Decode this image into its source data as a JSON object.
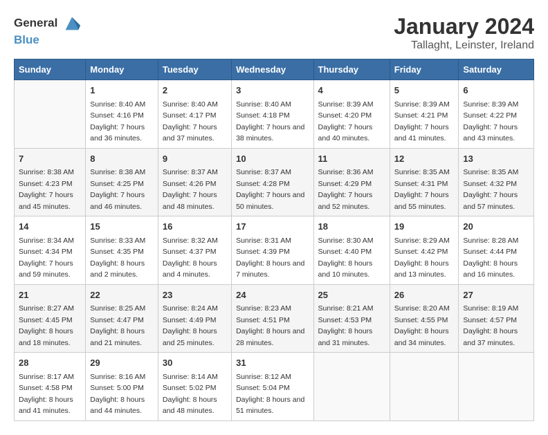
{
  "logo": {
    "general": "General",
    "blue": "Blue"
  },
  "title": "January 2024",
  "subtitle": "Tallaght, Leinster, Ireland",
  "days_of_week": [
    "Sunday",
    "Monday",
    "Tuesday",
    "Wednesday",
    "Thursday",
    "Friday",
    "Saturday"
  ],
  "weeks": [
    [
      {
        "day": "",
        "sunrise": "",
        "sunset": "",
        "daylight": ""
      },
      {
        "day": "1",
        "sunrise": "Sunrise: 8:40 AM",
        "sunset": "Sunset: 4:16 PM",
        "daylight": "Daylight: 7 hours and 36 minutes."
      },
      {
        "day": "2",
        "sunrise": "Sunrise: 8:40 AM",
        "sunset": "Sunset: 4:17 PM",
        "daylight": "Daylight: 7 hours and 37 minutes."
      },
      {
        "day": "3",
        "sunrise": "Sunrise: 8:40 AM",
        "sunset": "Sunset: 4:18 PM",
        "daylight": "Daylight: 7 hours and 38 minutes."
      },
      {
        "day": "4",
        "sunrise": "Sunrise: 8:39 AM",
        "sunset": "Sunset: 4:20 PM",
        "daylight": "Daylight: 7 hours and 40 minutes."
      },
      {
        "day": "5",
        "sunrise": "Sunrise: 8:39 AM",
        "sunset": "Sunset: 4:21 PM",
        "daylight": "Daylight: 7 hours and 41 minutes."
      },
      {
        "day": "6",
        "sunrise": "Sunrise: 8:39 AM",
        "sunset": "Sunset: 4:22 PM",
        "daylight": "Daylight: 7 hours and 43 minutes."
      }
    ],
    [
      {
        "day": "7",
        "sunrise": "Sunrise: 8:38 AM",
        "sunset": "Sunset: 4:23 PM",
        "daylight": "Daylight: 7 hours and 45 minutes."
      },
      {
        "day": "8",
        "sunrise": "Sunrise: 8:38 AM",
        "sunset": "Sunset: 4:25 PM",
        "daylight": "Daylight: 7 hours and 46 minutes."
      },
      {
        "day": "9",
        "sunrise": "Sunrise: 8:37 AM",
        "sunset": "Sunset: 4:26 PM",
        "daylight": "Daylight: 7 hours and 48 minutes."
      },
      {
        "day": "10",
        "sunrise": "Sunrise: 8:37 AM",
        "sunset": "Sunset: 4:28 PM",
        "daylight": "Daylight: 7 hours and 50 minutes."
      },
      {
        "day": "11",
        "sunrise": "Sunrise: 8:36 AM",
        "sunset": "Sunset: 4:29 PM",
        "daylight": "Daylight: 7 hours and 52 minutes."
      },
      {
        "day": "12",
        "sunrise": "Sunrise: 8:35 AM",
        "sunset": "Sunset: 4:31 PM",
        "daylight": "Daylight: 7 hours and 55 minutes."
      },
      {
        "day": "13",
        "sunrise": "Sunrise: 8:35 AM",
        "sunset": "Sunset: 4:32 PM",
        "daylight": "Daylight: 7 hours and 57 minutes."
      }
    ],
    [
      {
        "day": "14",
        "sunrise": "Sunrise: 8:34 AM",
        "sunset": "Sunset: 4:34 PM",
        "daylight": "Daylight: 7 hours and 59 minutes."
      },
      {
        "day": "15",
        "sunrise": "Sunrise: 8:33 AM",
        "sunset": "Sunset: 4:35 PM",
        "daylight": "Daylight: 8 hours and 2 minutes."
      },
      {
        "day": "16",
        "sunrise": "Sunrise: 8:32 AM",
        "sunset": "Sunset: 4:37 PM",
        "daylight": "Daylight: 8 hours and 4 minutes."
      },
      {
        "day": "17",
        "sunrise": "Sunrise: 8:31 AM",
        "sunset": "Sunset: 4:39 PM",
        "daylight": "Daylight: 8 hours and 7 minutes."
      },
      {
        "day": "18",
        "sunrise": "Sunrise: 8:30 AM",
        "sunset": "Sunset: 4:40 PM",
        "daylight": "Daylight: 8 hours and 10 minutes."
      },
      {
        "day": "19",
        "sunrise": "Sunrise: 8:29 AM",
        "sunset": "Sunset: 4:42 PM",
        "daylight": "Daylight: 8 hours and 13 minutes."
      },
      {
        "day": "20",
        "sunrise": "Sunrise: 8:28 AM",
        "sunset": "Sunset: 4:44 PM",
        "daylight": "Daylight: 8 hours and 16 minutes."
      }
    ],
    [
      {
        "day": "21",
        "sunrise": "Sunrise: 8:27 AM",
        "sunset": "Sunset: 4:45 PM",
        "daylight": "Daylight: 8 hours and 18 minutes."
      },
      {
        "day": "22",
        "sunrise": "Sunrise: 8:25 AM",
        "sunset": "Sunset: 4:47 PM",
        "daylight": "Daylight: 8 hours and 21 minutes."
      },
      {
        "day": "23",
        "sunrise": "Sunrise: 8:24 AM",
        "sunset": "Sunset: 4:49 PM",
        "daylight": "Daylight: 8 hours and 25 minutes."
      },
      {
        "day": "24",
        "sunrise": "Sunrise: 8:23 AM",
        "sunset": "Sunset: 4:51 PM",
        "daylight": "Daylight: 8 hours and 28 minutes."
      },
      {
        "day": "25",
        "sunrise": "Sunrise: 8:21 AM",
        "sunset": "Sunset: 4:53 PM",
        "daylight": "Daylight: 8 hours and 31 minutes."
      },
      {
        "day": "26",
        "sunrise": "Sunrise: 8:20 AM",
        "sunset": "Sunset: 4:55 PM",
        "daylight": "Daylight: 8 hours and 34 minutes."
      },
      {
        "day": "27",
        "sunrise": "Sunrise: 8:19 AM",
        "sunset": "Sunset: 4:57 PM",
        "daylight": "Daylight: 8 hours and 37 minutes."
      }
    ],
    [
      {
        "day": "28",
        "sunrise": "Sunrise: 8:17 AM",
        "sunset": "Sunset: 4:58 PM",
        "daylight": "Daylight: 8 hours and 41 minutes."
      },
      {
        "day": "29",
        "sunrise": "Sunrise: 8:16 AM",
        "sunset": "Sunset: 5:00 PM",
        "daylight": "Daylight: 8 hours and 44 minutes."
      },
      {
        "day": "30",
        "sunrise": "Sunrise: 8:14 AM",
        "sunset": "Sunset: 5:02 PM",
        "daylight": "Daylight: 8 hours and 48 minutes."
      },
      {
        "day": "31",
        "sunrise": "Sunrise: 8:12 AM",
        "sunset": "Sunset: 5:04 PM",
        "daylight": "Daylight: 8 hours and 51 minutes."
      },
      {
        "day": "",
        "sunrise": "",
        "sunset": "",
        "daylight": ""
      },
      {
        "day": "",
        "sunrise": "",
        "sunset": "",
        "daylight": ""
      },
      {
        "day": "",
        "sunrise": "",
        "sunset": "",
        "daylight": ""
      }
    ]
  ]
}
